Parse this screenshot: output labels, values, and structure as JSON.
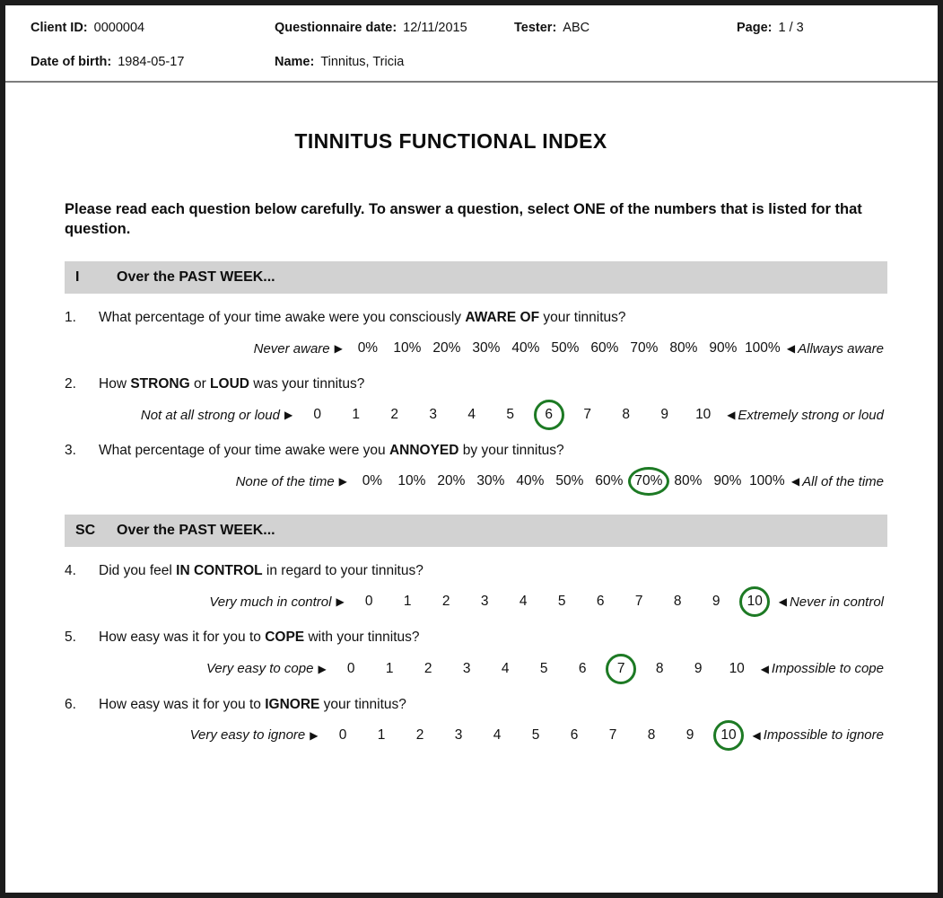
{
  "header": {
    "fields": [
      {
        "label": "Client ID:",
        "value": "0000004"
      },
      {
        "label": "Questionnaire date:",
        "value": "12/11/2015"
      },
      {
        "label": "Tester:",
        "value": "ABC"
      },
      {
        "label": "Page:",
        "value": "1 / 3"
      },
      {
        "label": "Date of birth:",
        "value": "1984-05-17"
      },
      {
        "label": "Name:",
        "value": "Tinnitus, Tricia"
      }
    ]
  },
  "document": {
    "title": "TINNITUS FUNCTIONAL INDEX",
    "instructions": "Please read each question below carefully. To answer a question, select ONE of the numbers that is listed for that question."
  },
  "colors": {
    "band_gray": "#d2d2d2",
    "selection_green": "#1d7a24",
    "page_border": "#1c1c1c"
  },
  "markers": {
    "arrow_right": "▶",
    "arrow_left": "◀"
  },
  "sections": [
    {
      "code": "I",
      "label": "Over the PAST WEEK...",
      "questions": [
        {
          "number": "1.",
          "text_before": "What percentage of your time awake were you consciously ",
          "text_bold": "AWARE OF",
          "text_after": " your tinnitus?",
          "anchor_left": "Never aware",
          "anchor_right": "Allways aware",
          "scale_type": "pct",
          "options": [
            "0%",
            "10%",
            "20%",
            "30%",
            "40%",
            "50%",
            "60%",
            "70%",
            "80%",
            "90%",
            "100%"
          ],
          "selected": null
        },
        {
          "number": "2.",
          "text_before": "How ",
          "text_bold": "STRONG",
          "text_mid": " or ",
          "text_bold2": "LOUD",
          "text_after": " was your tinnitus?",
          "anchor_left": "Not at all strong or loud",
          "anchor_right": "Extremely strong or loud",
          "scale_type": "num",
          "options": [
            "0",
            "1",
            "2",
            "3",
            "4",
            "5",
            "6",
            "7",
            "8",
            "9",
            "10"
          ],
          "selected": "6"
        },
        {
          "number": "3.",
          "text_before": "What percentage of your time awake were you ",
          "text_bold": "ANNOYED",
          "text_after": " by your tinnitus?",
          "anchor_left": "None of the time",
          "anchor_right": "All of the time",
          "scale_type": "pct",
          "options": [
            "0%",
            "10%",
            "20%",
            "30%",
            "40%",
            "50%",
            "60%",
            "70%",
            "80%",
            "90%",
            "100%"
          ],
          "selected": "70%"
        }
      ]
    },
    {
      "code": "SC",
      "label": "Over the PAST WEEK...",
      "questions": [
        {
          "number": "4.",
          "text_before": "Did you feel ",
          "text_bold": "IN CONTROL",
          "text_after": " in regard to your tinnitus?",
          "anchor_left": "Very much in control",
          "anchor_right": "Never in control",
          "scale_type": "num",
          "options": [
            "0",
            "1",
            "2",
            "3",
            "4",
            "5",
            "6",
            "7",
            "8",
            "9",
            "10"
          ],
          "selected": "10"
        },
        {
          "number": "5.",
          "text_before": "How easy was it for you to ",
          "text_bold": "COPE",
          "text_after": " with your tinnitus?",
          "anchor_left": "Very easy to cope",
          "anchor_right": "Impossible to cope",
          "scale_type": "num",
          "options": [
            "0",
            "1",
            "2",
            "3",
            "4",
            "5",
            "6",
            "7",
            "8",
            "9",
            "10"
          ],
          "selected": "7"
        },
        {
          "number": "6.",
          "text_before": "How easy was it for you to ",
          "text_bold": "IGNORE",
          "text_after": " your tinnitus?",
          "anchor_left": "Very easy to ignore",
          "anchor_right": "Impossible to ignore",
          "scale_type": "num",
          "options": [
            "0",
            "1",
            "2",
            "3",
            "4",
            "5",
            "6",
            "7",
            "8",
            "9",
            "10"
          ],
          "selected": "10"
        }
      ]
    }
  ]
}
